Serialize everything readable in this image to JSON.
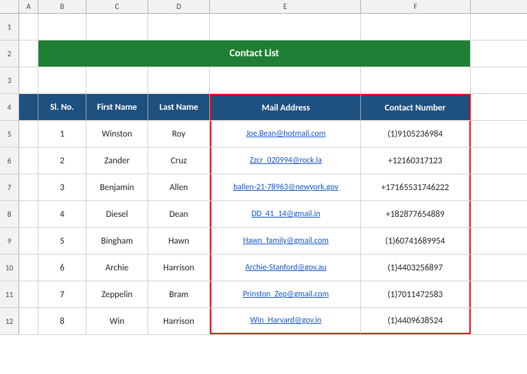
{
  "title": "Contact List",
  "columns": {
    "letters": [
      "A",
      "B",
      "C",
      "D",
      "E",
      "F"
    ],
    "headers": [
      "Sl. No.",
      "First Name",
      "Last Name",
      "Mail Address",
      "Contact Number"
    ]
  },
  "rows": [
    {
      "sl": "1",
      "first": "Winston",
      "last": "Roy",
      "email": "Joe.Bean@hotmail.com",
      "phone": "(1)9105236984"
    },
    {
      "sl": "2",
      "first": "Zander",
      "last": "Cruz",
      "email": "Zzcr_020994@rock.la",
      "phone": "+12160317123"
    },
    {
      "sl": "3",
      "first": "Benjamin",
      "last": "Allen",
      "email": "ballen-21-78963@newyork.gov",
      "phone": "+17165531746222"
    },
    {
      "sl": "4",
      "first": "Diesel",
      "last": "Dean",
      "email": "DD_41_14@gmail.in",
      "phone": "+182877654889"
    },
    {
      "sl": "5",
      "first": "Bingham",
      "last": "Hawn",
      "email": "Hawn_family@gmail.com",
      "phone": "(1)60741689954"
    },
    {
      "sl": "6",
      "first": "Archie",
      "last": "Harrison",
      "email": "Archie-Stanford@gov.au",
      "phone": "(1)4403256897"
    },
    {
      "sl": "7",
      "first": "Zeppelin",
      "last": "Bram",
      "email": "Prinston_Zep@gmail.com",
      "phone": "(1)7011472583"
    },
    {
      "sl": "8",
      "first": "Win",
      "last": "Harrison",
      "email": "Win_Harvard@gov.in",
      "phone": "(1)4409638524"
    }
  ],
  "row_numbers": [
    "1",
    "2",
    "3",
    "4",
    "5",
    "6",
    "7",
    "8",
    "9",
    "10",
    "11",
    "12"
  ],
  "colors": {
    "title_bg": "#1e8c3a",
    "header_bg": "#1e5080",
    "red_border": "#ff0000"
  }
}
